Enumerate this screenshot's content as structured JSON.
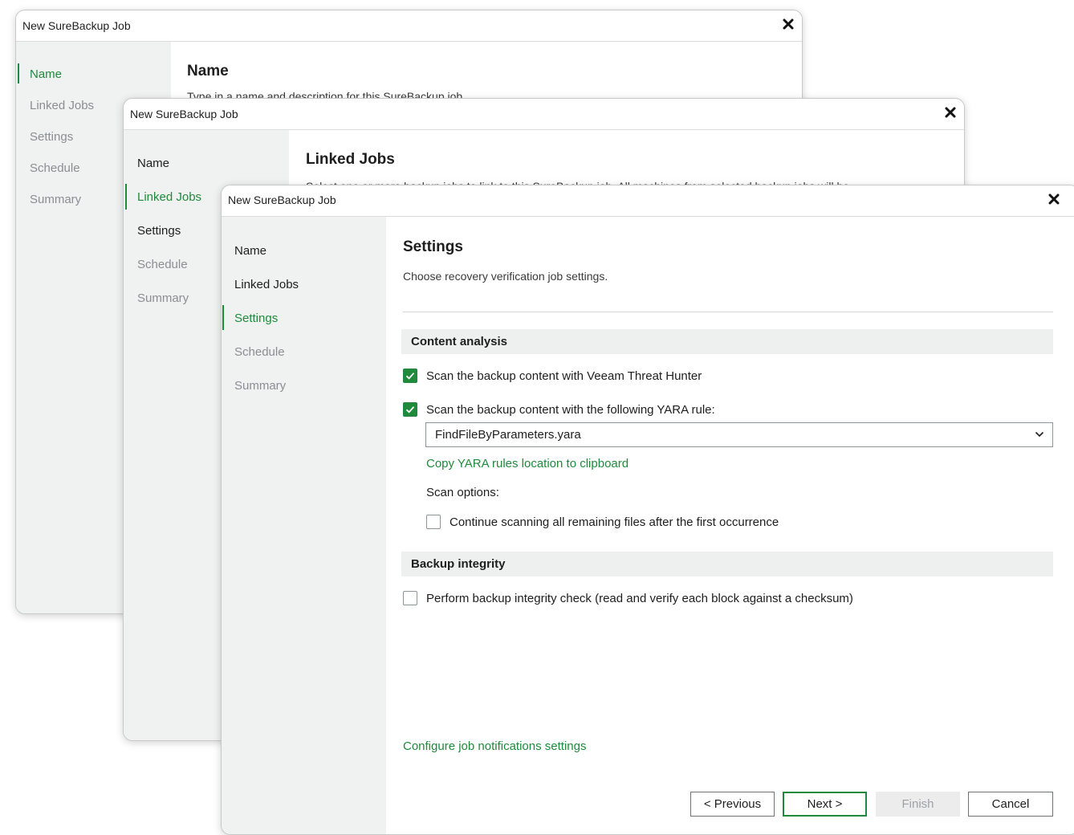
{
  "windows": [
    {
      "title": "New SureBackup Job",
      "nav": [
        {
          "label": "Name",
          "state": "active"
        },
        {
          "label": "Linked Jobs",
          "state": "disabled"
        },
        {
          "label": "Settings",
          "state": "disabled"
        },
        {
          "label": "Schedule",
          "state": "disabled"
        },
        {
          "label": "Summary",
          "state": "disabled"
        }
      ],
      "page_title": "Name",
      "page_desc": "Type in a name and description for this SureBackup job."
    },
    {
      "title": "New SureBackup Job",
      "nav": [
        {
          "label": "Name",
          "state": "normal"
        },
        {
          "label": "Linked Jobs",
          "state": "active"
        },
        {
          "label": "Settings",
          "state": "normal"
        },
        {
          "label": "Schedule",
          "state": "disabled"
        },
        {
          "label": "Summary",
          "state": "disabled"
        }
      ],
      "page_title": "Linked Jobs",
      "page_desc": "Select one or more backup jobs to link to this SureBackup job. All machines from selected backup jobs will be"
    },
    {
      "title": "New SureBackup Job",
      "nav": [
        {
          "label": "Name",
          "state": "normal"
        },
        {
          "label": "Linked Jobs",
          "state": "normal"
        },
        {
          "label": "Settings",
          "state": "active"
        },
        {
          "label": "Schedule",
          "state": "disabled"
        },
        {
          "label": "Summary",
          "state": "disabled"
        }
      ],
      "page_title": "Settings",
      "page_desc": "Choose recovery verification job settings.",
      "content_analysis": {
        "header": "Content analysis",
        "threat_hunter": {
          "label": "Scan the backup content with Veeam Threat Hunter",
          "checked": true
        },
        "yara": {
          "label": "Scan the backup content with the following YARA rule:",
          "checked": true
        },
        "yara_rule_value": "FindFileByParameters.yara",
        "copy_link": "Copy YARA rules location to clipboard",
        "scan_options_label": "Scan options:",
        "continue_scanning": {
          "label": "Continue scanning all remaining files after the first occurrence",
          "checked": false
        }
      },
      "backup_integrity": {
        "header": "Backup integrity",
        "integrity_check": {
          "label": "Perform backup integrity check (read and verify each block against a checksum)",
          "checked": false
        }
      },
      "notifications_link": "Configure job notifications settings",
      "buttons": {
        "previous": "< Previous",
        "next": "Next >",
        "finish": "Finish",
        "cancel": "Cancel"
      }
    }
  ],
  "colors": {
    "accent": "#1f8a3c",
    "sidebar_bg": "#f0f1f1",
    "section_bg": "#eef0f0"
  },
  "icons": {
    "close": "close-icon",
    "check": "checkmark-icon",
    "dropdown": "chevron-down-icon"
  }
}
